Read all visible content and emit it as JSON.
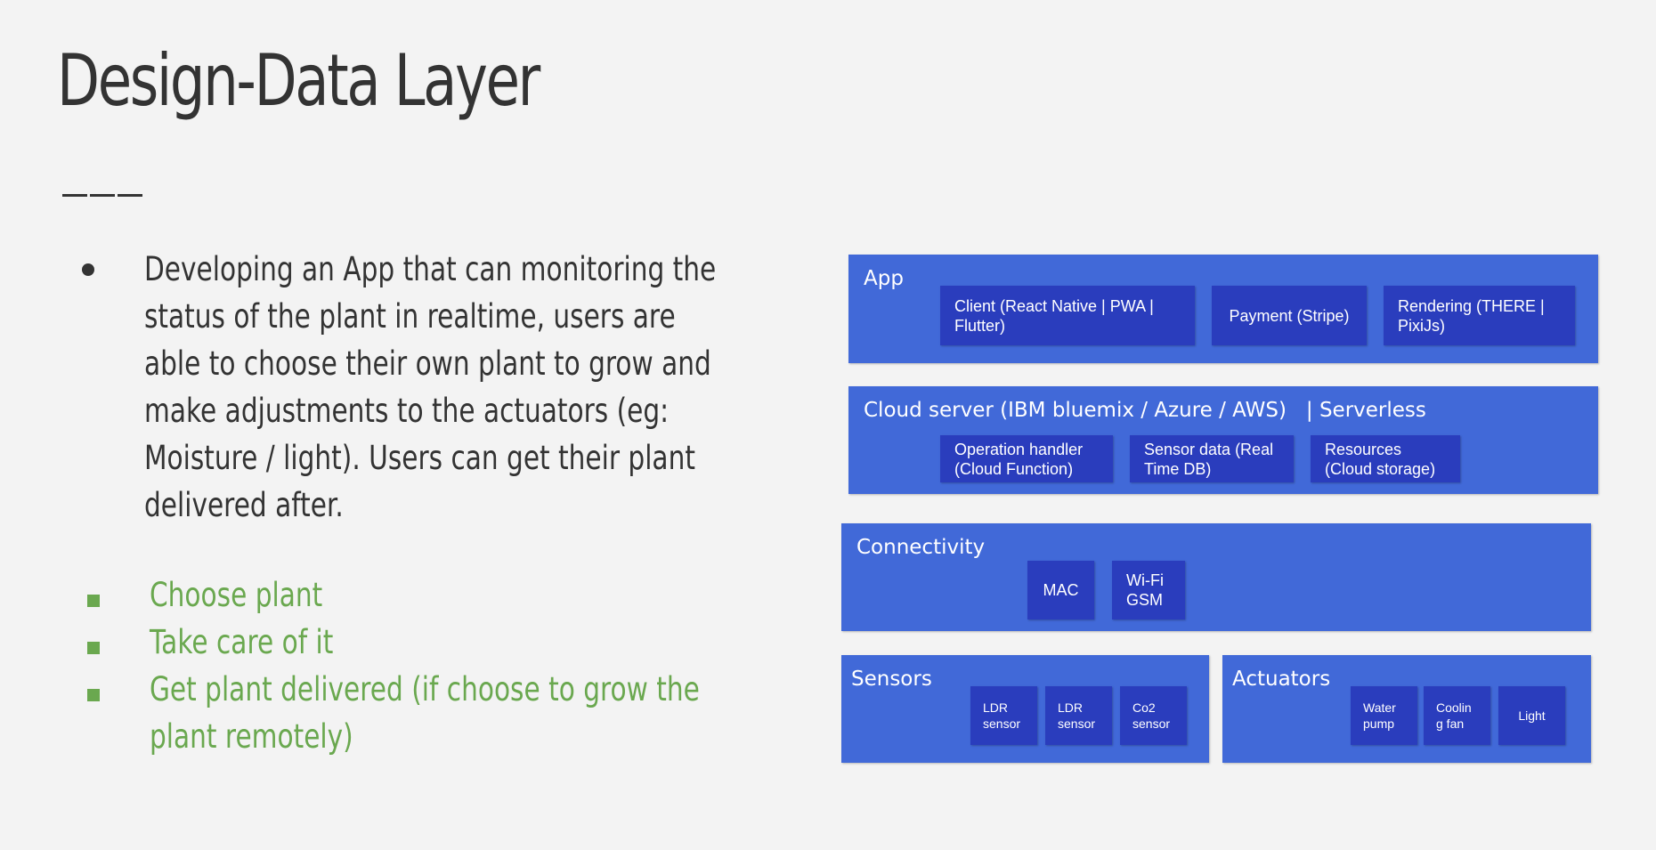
{
  "title": "Design-Data Layer",
  "description": "Developing an App that can monitoring the status of the plant in realtime, users are able to choose their own plant to grow and make adjustments to the actuators (eg: Moisture / light). Users can get their plant delivered after.",
  "steps": [
    "Choose plant",
    "Take care of it",
    "Get plant delivered (if choose to grow the plant remotely)"
  ],
  "diagram": {
    "app": {
      "title": "App",
      "items": [
        "Client (React Native | PWA | Flutter)",
        "Payment (Stripe)",
        "Rendering (THERE | PixiJs)"
      ]
    },
    "cloud": {
      "title": "Cloud server (IBM bluemix / Azure / AWS)   | Serverless",
      "items": [
        "Operation handler (Cloud Function)",
        "Sensor data (Real Time DB)",
        "Resources (Cloud storage)"
      ]
    },
    "connectivity": {
      "title": "Connectivity",
      "items": [
        "MAC",
        "Wi-Fi GSM"
      ]
    },
    "sensors": {
      "title": "Sensors",
      "items": [
        "LDR sensor",
        "LDR sensor",
        "Co2 sensor"
      ]
    },
    "actuators": {
      "title": "Actuators",
      "items": [
        "Water pump",
        "Coolin g fan",
        "Light"
      ]
    }
  },
  "colors": {
    "layer": "#4169d8",
    "box": "#2a3dbd",
    "accent_green": "#6aa84f",
    "text_dark": "#333333"
  }
}
